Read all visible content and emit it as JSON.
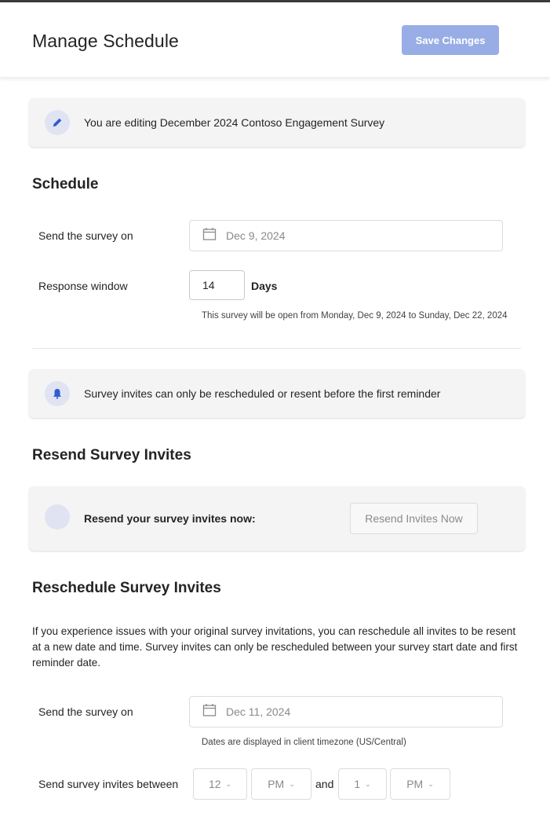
{
  "header": {
    "title": "Manage Schedule",
    "save_label": "Save Changes"
  },
  "editing_banner": {
    "icon": "pencil-icon",
    "text": "You are editing December 2024 Contoso Engagement Survey"
  },
  "schedule": {
    "title": "Schedule",
    "send_label": "Send the survey on",
    "send_date": "Dec 9, 2024",
    "response_label": "Response window",
    "response_value": "14",
    "response_unit": "Days",
    "open_hint": "This survey will be open from Monday, Dec 9, 2024 to Sunday, Dec 22, 2024"
  },
  "reminder_banner": {
    "icon": "bell-icon",
    "text": "Survey invites can only be rescheduled or resent before the first reminder"
  },
  "resend": {
    "title": "Resend Survey Invites",
    "prompt": "Resend your survey invites now:",
    "button_label": "Resend Invites Now"
  },
  "reschedule": {
    "title": "Reschedule Survey Invites",
    "description": "If you experience issues with your original survey invitations, you can reschedule all invites to be resent at a new date and time. Survey invites can only be rescheduled between your survey start date and first reminder date.",
    "send_label": "Send the survey on",
    "send_date": "Dec 11, 2024",
    "timezone_hint": "Dates are displayed in client timezone (US/Central)",
    "between_label": "Send survey invites between",
    "start_hour": "12",
    "start_period": "PM",
    "and_label": "and",
    "end_hour": "1",
    "end_period": "PM"
  },
  "colors": {
    "accent": "#2f5bd3",
    "save_button": "#98ade5",
    "card_bg": "#f4f4f4",
    "icon_circle": "#e0e3f2"
  }
}
